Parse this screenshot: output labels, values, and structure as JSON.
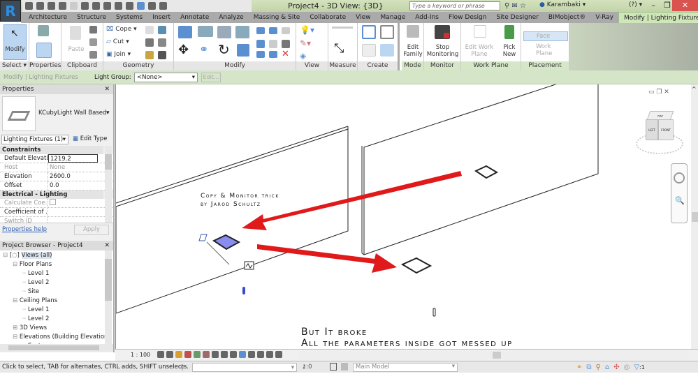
{
  "app": {
    "logo": "R",
    "title": "Project4 - 3D View: {3D}",
    "search_placeholder": "Type a keyword or phrase",
    "user": "Karambaki",
    "help": "?"
  },
  "tabs": [
    "Architecture",
    "Structure",
    "Systems",
    "Insert",
    "Annotate",
    "Analyze",
    "Massing & Site",
    "Collaborate",
    "View",
    "Manage",
    "Add-Ins",
    "Flow Design",
    "Site Designer",
    "BIMobject®",
    "V-Ray",
    "Modify | Lighting Fixtures"
  ],
  "ribbon": {
    "modify_label": "Modify",
    "paste_label": "Paste",
    "cope": "Cope",
    "cut": "Cut",
    "join": "Join",
    "edit_family": "Edit Family",
    "stop_monitoring": "Stop Monitoring",
    "edit_work_plane": "Edit Work Plane",
    "pick_new": "Pick New",
    "face": "Face",
    "work_plane": "Work Plane",
    "panels": [
      "Select",
      "Properties",
      "Clipboard",
      "Geometry",
      "Modify",
      "View",
      "Measure",
      "Create",
      "Mode",
      "Monitor",
      "Work Plane",
      "Placement"
    ]
  },
  "options_bar": {
    "context": "Modify | Lighting Fixtures",
    "light_group_label": "Light Group:",
    "light_group_value": "<None>",
    "edit_button": "Edit..."
  },
  "properties": {
    "title": "Properties",
    "type_name": "KCubyLight Wall Based",
    "filter": "Lighting Fixtures (1)",
    "edit_type": "Edit Type",
    "sections": [
      {
        "name": "Constraints",
        "rows": [
          {
            "key": "Default Elevati...",
            "value": "1219.2"
          },
          {
            "key": "Host",
            "value": "None"
          },
          {
            "key": "Elevation",
            "value": "2600.0"
          },
          {
            "key": "Offset",
            "value": "0.0"
          }
        ]
      },
      {
        "name": "Electrical - Lighting",
        "rows": [
          {
            "key": "Calculate Coe...",
            "value": ""
          },
          {
            "key": "Coefficient of ...",
            "value": ""
          },
          {
            "key": "Switch ID",
            "value": ""
          }
        ]
      }
    ],
    "help_link": "Properties help",
    "apply": "Apply"
  },
  "browser": {
    "title": "Project Browser - Project4",
    "items": [
      {
        "label": "Views (all)",
        "level": 0,
        "toggle": "−"
      },
      {
        "label": "Floor Plans",
        "level": 1,
        "toggle": "−"
      },
      {
        "label": "Level 1",
        "level": 2,
        "toggle": ""
      },
      {
        "label": "Level 2",
        "level": 2,
        "toggle": ""
      },
      {
        "label": "Site",
        "level": 2,
        "toggle": ""
      },
      {
        "label": "Ceiling Plans",
        "level": 1,
        "toggle": "−"
      },
      {
        "label": "Level 1",
        "level": 2,
        "toggle": ""
      },
      {
        "label": "Level 2",
        "level": 2,
        "toggle": ""
      },
      {
        "label": "3D Views",
        "level": 1,
        "toggle": "+"
      },
      {
        "label": "Elevations (Building Elevation",
        "level": 1,
        "toggle": "−"
      },
      {
        "label": "East",
        "level": 2,
        "toggle": ""
      }
    ]
  },
  "canvas": {
    "note1_line1": "Copy & Monitor trick",
    "note1_line2": "by Jarod Schultz",
    "note2_line1": "But It broke",
    "note2_line2": "All the parameters inside got messed up",
    "viewcube": {
      "top": "TOP",
      "left": "LEFT",
      "front": "FRONT"
    },
    "arrow_color": "#e0191b"
  },
  "view_bar": {
    "scale": "1 : 100"
  },
  "status": {
    "message": "Click to select, TAB for alternates, CTRL adds, SHIFT unselects.",
    "count": ":0",
    "model": "Main Model",
    "filter": ":1"
  }
}
